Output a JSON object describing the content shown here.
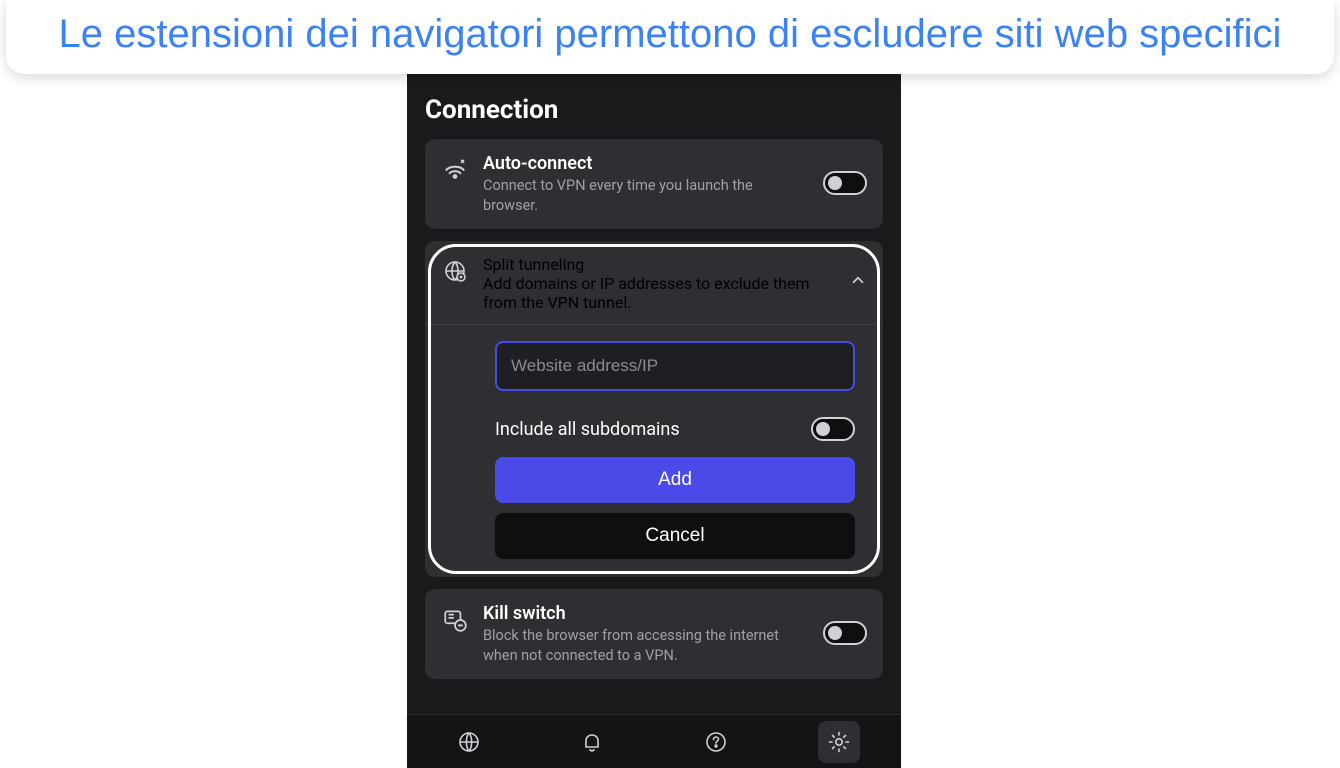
{
  "caption": "Le estensioni dei navigatori permettono di escludere siti web specifici",
  "section_title": "Connection",
  "auto_connect": {
    "title": "Auto-connect",
    "desc": "Connect to VPN every time you launch the browser."
  },
  "split_tunneling": {
    "title": "Split tunneling",
    "desc": "Add domains or IP addresses to exclude them from the VPN tunnel.",
    "input_placeholder": "Website address/IP",
    "subdomains_label": "Include all subdomains",
    "add_label": "Add",
    "cancel_label": "Cancel"
  },
  "kill_switch": {
    "title": "Kill switch",
    "desc": "Block the browser from accessing the internet when not connected to a VPN."
  }
}
